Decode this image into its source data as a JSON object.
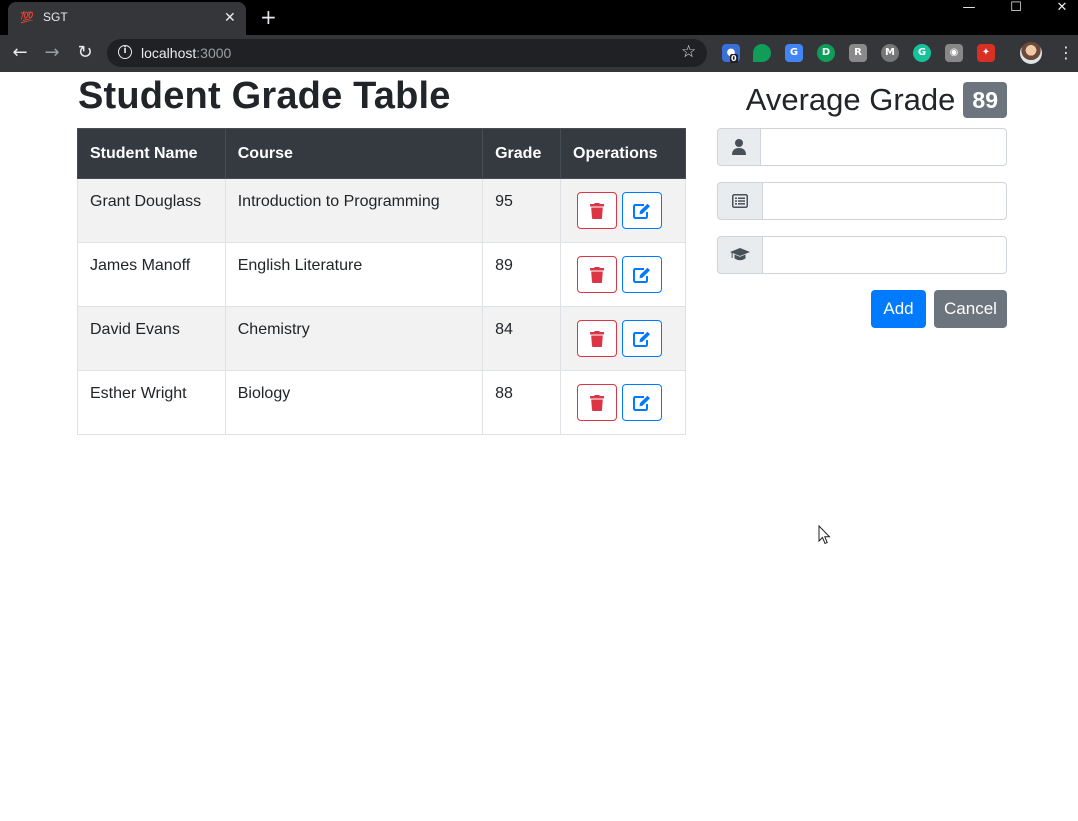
{
  "browser": {
    "tab_title": "SGT",
    "tab_favicon": "💯",
    "url_host": "localhost",
    "url_port": ":3000",
    "extension_badge": "0"
  },
  "page": {
    "title": "Student Grade Table",
    "average_label": "Average Grade",
    "average_value": "89"
  },
  "table": {
    "headers": [
      "Student Name",
      "Course",
      "Grade",
      "Operations"
    ],
    "rows": [
      {
        "name": "Grant Douglass",
        "course": "Introduction to Programming",
        "grade": "95"
      },
      {
        "name": "James Manoff",
        "course": "English Literature",
        "grade": "89"
      },
      {
        "name": "David Evans",
        "course": "Chemistry",
        "grade": "84"
      },
      {
        "name": "Esther Wright",
        "course": "Biology",
        "grade": "88"
      }
    ]
  },
  "form": {
    "name_value": "",
    "course_value": "",
    "grade_value": "",
    "add_label": "Add",
    "cancel_label": "Cancel"
  },
  "icons": {
    "delete": "trash-icon",
    "edit": "edit-icon",
    "name": "user-icon",
    "course": "list-icon",
    "grade": "graduation-cap-icon"
  },
  "colors": {
    "primary": "#007bff",
    "danger": "#dc3545",
    "secondary": "#6c757d",
    "table_header": "#343a40"
  }
}
